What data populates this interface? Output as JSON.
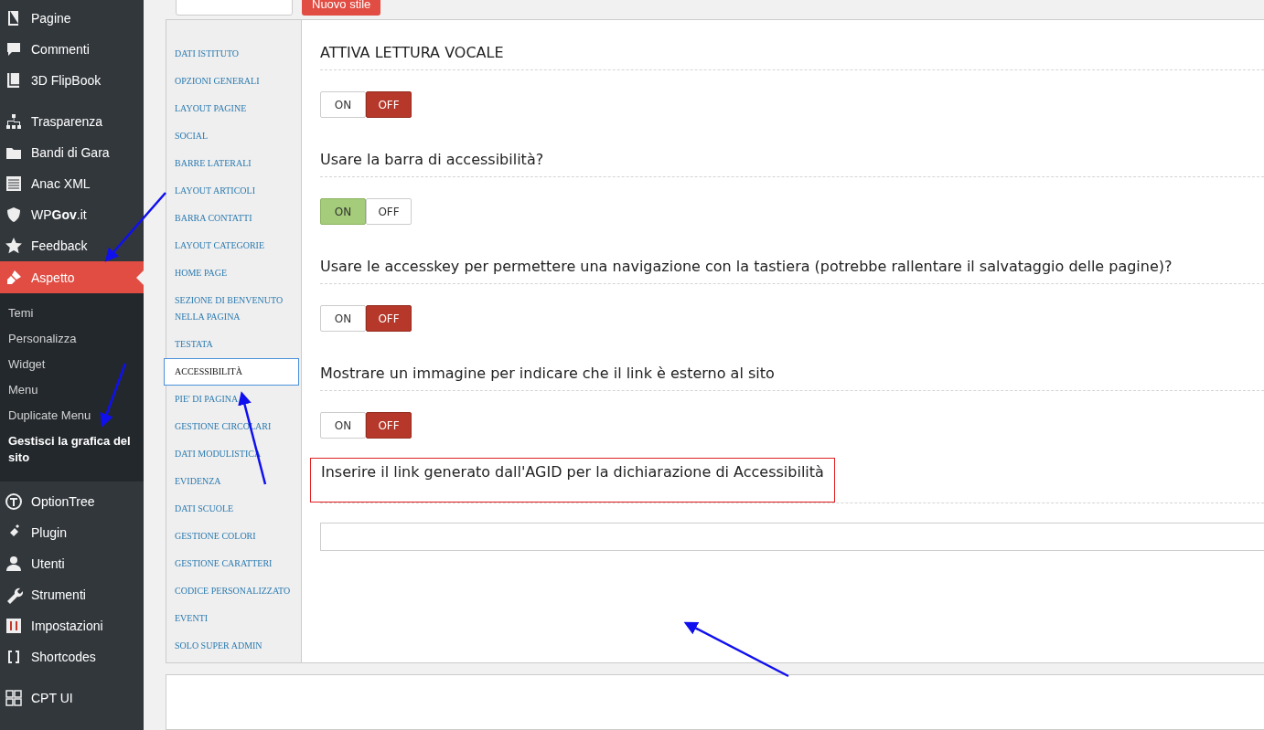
{
  "admin_menu": {
    "items_top": [
      {
        "label": "Pagine"
      },
      {
        "label": "Commenti"
      },
      {
        "label": "3D FlipBook"
      },
      {
        "label": "Trasparenza",
        "gap": true
      },
      {
        "label": "Bandi di Gara"
      },
      {
        "label": "Anac XML"
      },
      {
        "label": "WP**Gov**.it"
      },
      {
        "label": "Feedback"
      }
    ],
    "current": {
      "label": "Aspetto",
      "submenu": [
        {
          "label": "Temi",
          "selected": false
        },
        {
          "label": "Personalizza",
          "selected": false
        },
        {
          "label": "Widget",
          "selected": false
        },
        {
          "label": "Menu",
          "selected": false
        },
        {
          "label": "Duplicate Menu",
          "selected": false
        },
        {
          "label": "Gestisci la grafica del sito",
          "selected": true
        }
      ]
    },
    "items_bottom": [
      {
        "label": "OptionTree"
      },
      {
        "label": "Plugin"
      },
      {
        "label": "Utenti"
      },
      {
        "label": "Strumenti"
      },
      {
        "label": "Impostazioni"
      },
      {
        "label": "Shortcodes"
      },
      {
        "label": "CPT UI",
        "gap": true
      }
    ]
  },
  "new_style_button": "Nuovo stile",
  "options_nav": [
    {
      "label": "DATI ISTITUTO",
      "selected": false
    },
    {
      "label": "OPZIONI GENERALI",
      "selected": false
    },
    {
      "label": "LAYOUT PAGINE",
      "selected": false
    },
    {
      "label": "SOCIAL",
      "selected": false
    },
    {
      "label": "BARRE LATERALI",
      "selected": false
    },
    {
      "label": "LAYOUT ARTICOLI",
      "selected": false
    },
    {
      "label": "BARRA CONTATTI",
      "selected": false
    },
    {
      "label": "LAYOUT CATEGORIE",
      "selected": false
    },
    {
      "label": "HOME PAGE",
      "selected": false
    },
    {
      "label": "SEZIONE DI BENVENUTO NELLA PAGINA",
      "selected": false
    },
    {
      "label": "TESTATA",
      "selected": false
    },
    {
      "label": "ACCESSIBILITÀ",
      "selected": true
    },
    {
      "label": "PIE' DI PAGINA",
      "selected": false
    },
    {
      "label": "GESTIONE CIRCOLARI",
      "selected": false
    },
    {
      "label": "DATI MODULISTICA",
      "selected": false
    },
    {
      "label": "EVIDENZA",
      "selected": false
    },
    {
      "label": "DATI SCUOLE",
      "selected": false
    },
    {
      "label": "GESTIONE COLORI",
      "selected": false
    },
    {
      "label": "GESTIONE CARATTERI",
      "selected": false
    },
    {
      "label": "CODICE PERSONALIZZATO",
      "selected": false
    },
    {
      "label": "EVENTI",
      "selected": false
    },
    {
      "label": "SOLO SUPER ADMIN",
      "selected": false
    }
  ],
  "settings": [
    {
      "kind": "toggle",
      "label": "ATTIVA LETTURA VOCALE",
      "on": false,
      "on_label": "ON",
      "off_label": "OFF",
      "highlighted": false
    },
    {
      "kind": "toggle",
      "label": "Usare la barra di accessibilità?",
      "on": true,
      "on_label": "ON",
      "off_label": "OFF",
      "highlighted": false
    },
    {
      "kind": "toggle",
      "label": "Usare le accesskey per permettere una navigazione con la tastiera (potrebbe rallentare il salvataggio delle pagine)?",
      "on": false,
      "on_label": "ON",
      "off_label": "OFF",
      "highlighted": false
    },
    {
      "kind": "toggle",
      "label": "Mostrare un immagine per indicare che il link è esterno al sito",
      "on": false,
      "on_label": "ON",
      "off_label": "OFF",
      "highlighted": false
    },
    {
      "kind": "text",
      "label": "Inserire il link generato dall'AGID per la dichiarazione di Accessibilità",
      "highlighted": true
    }
  ]
}
